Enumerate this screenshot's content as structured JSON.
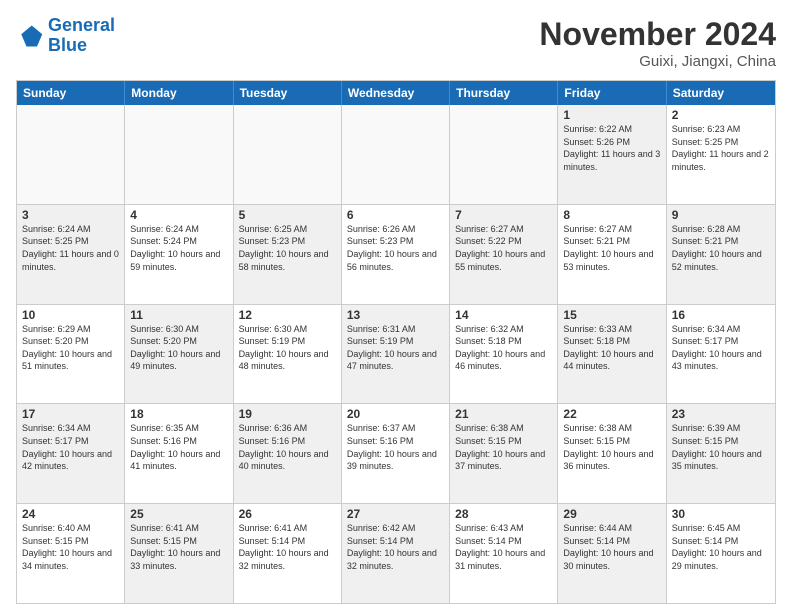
{
  "logo": {
    "line1": "General",
    "line2": "Blue"
  },
  "title": "November 2024",
  "subtitle": "Guixi, Jiangxi, China",
  "days_of_week": [
    "Sunday",
    "Monday",
    "Tuesday",
    "Wednesday",
    "Thursday",
    "Friday",
    "Saturday"
  ],
  "weeks": [
    [
      {
        "day": "",
        "info": "",
        "empty": true
      },
      {
        "day": "",
        "info": "",
        "empty": true
      },
      {
        "day": "",
        "info": "",
        "empty": true
      },
      {
        "day": "",
        "info": "",
        "empty": true
      },
      {
        "day": "",
        "info": "",
        "empty": true
      },
      {
        "day": "1",
        "info": "Sunrise: 6:22 AM\nSunset: 5:26 PM\nDaylight: 11 hours and 3 minutes.",
        "shaded": true
      },
      {
        "day": "2",
        "info": "Sunrise: 6:23 AM\nSunset: 5:25 PM\nDaylight: 11 hours and 2 minutes.",
        "shaded": false
      }
    ],
    [
      {
        "day": "3",
        "info": "Sunrise: 6:24 AM\nSunset: 5:25 PM\nDaylight: 11 hours and 0 minutes.",
        "shaded": true
      },
      {
        "day": "4",
        "info": "Sunrise: 6:24 AM\nSunset: 5:24 PM\nDaylight: 10 hours and 59 minutes.",
        "shaded": false
      },
      {
        "day": "5",
        "info": "Sunrise: 6:25 AM\nSunset: 5:23 PM\nDaylight: 10 hours and 58 minutes.",
        "shaded": true
      },
      {
        "day": "6",
        "info": "Sunrise: 6:26 AM\nSunset: 5:23 PM\nDaylight: 10 hours and 56 minutes.",
        "shaded": false
      },
      {
        "day": "7",
        "info": "Sunrise: 6:27 AM\nSunset: 5:22 PM\nDaylight: 10 hours and 55 minutes.",
        "shaded": true
      },
      {
        "day": "8",
        "info": "Sunrise: 6:27 AM\nSunset: 5:21 PM\nDaylight: 10 hours and 53 minutes.",
        "shaded": false
      },
      {
        "day": "9",
        "info": "Sunrise: 6:28 AM\nSunset: 5:21 PM\nDaylight: 10 hours and 52 minutes.",
        "shaded": true
      }
    ],
    [
      {
        "day": "10",
        "info": "Sunrise: 6:29 AM\nSunset: 5:20 PM\nDaylight: 10 hours and 51 minutes.",
        "shaded": false
      },
      {
        "day": "11",
        "info": "Sunrise: 6:30 AM\nSunset: 5:20 PM\nDaylight: 10 hours and 49 minutes.",
        "shaded": true
      },
      {
        "day": "12",
        "info": "Sunrise: 6:30 AM\nSunset: 5:19 PM\nDaylight: 10 hours and 48 minutes.",
        "shaded": false
      },
      {
        "day": "13",
        "info": "Sunrise: 6:31 AM\nSunset: 5:19 PM\nDaylight: 10 hours and 47 minutes.",
        "shaded": true
      },
      {
        "day": "14",
        "info": "Sunrise: 6:32 AM\nSunset: 5:18 PM\nDaylight: 10 hours and 46 minutes.",
        "shaded": false
      },
      {
        "day": "15",
        "info": "Sunrise: 6:33 AM\nSunset: 5:18 PM\nDaylight: 10 hours and 44 minutes.",
        "shaded": true
      },
      {
        "day": "16",
        "info": "Sunrise: 6:34 AM\nSunset: 5:17 PM\nDaylight: 10 hours and 43 minutes.",
        "shaded": false
      }
    ],
    [
      {
        "day": "17",
        "info": "Sunrise: 6:34 AM\nSunset: 5:17 PM\nDaylight: 10 hours and 42 minutes.",
        "shaded": true
      },
      {
        "day": "18",
        "info": "Sunrise: 6:35 AM\nSunset: 5:16 PM\nDaylight: 10 hours and 41 minutes.",
        "shaded": false
      },
      {
        "day": "19",
        "info": "Sunrise: 6:36 AM\nSunset: 5:16 PM\nDaylight: 10 hours and 40 minutes.",
        "shaded": true
      },
      {
        "day": "20",
        "info": "Sunrise: 6:37 AM\nSunset: 5:16 PM\nDaylight: 10 hours and 39 minutes.",
        "shaded": false
      },
      {
        "day": "21",
        "info": "Sunrise: 6:38 AM\nSunset: 5:15 PM\nDaylight: 10 hours and 37 minutes.",
        "shaded": true
      },
      {
        "day": "22",
        "info": "Sunrise: 6:38 AM\nSunset: 5:15 PM\nDaylight: 10 hours and 36 minutes.",
        "shaded": false
      },
      {
        "day": "23",
        "info": "Sunrise: 6:39 AM\nSunset: 5:15 PM\nDaylight: 10 hours and 35 minutes.",
        "shaded": true
      }
    ],
    [
      {
        "day": "24",
        "info": "Sunrise: 6:40 AM\nSunset: 5:15 PM\nDaylight: 10 hours and 34 minutes.",
        "shaded": false
      },
      {
        "day": "25",
        "info": "Sunrise: 6:41 AM\nSunset: 5:15 PM\nDaylight: 10 hours and 33 minutes.",
        "shaded": true
      },
      {
        "day": "26",
        "info": "Sunrise: 6:41 AM\nSunset: 5:14 PM\nDaylight: 10 hours and 32 minutes.",
        "shaded": false
      },
      {
        "day": "27",
        "info": "Sunrise: 6:42 AM\nSunset: 5:14 PM\nDaylight: 10 hours and 32 minutes.",
        "shaded": true
      },
      {
        "day": "28",
        "info": "Sunrise: 6:43 AM\nSunset: 5:14 PM\nDaylight: 10 hours and 31 minutes.",
        "shaded": false
      },
      {
        "day": "29",
        "info": "Sunrise: 6:44 AM\nSunset: 5:14 PM\nDaylight: 10 hours and 30 minutes.",
        "shaded": true
      },
      {
        "day": "30",
        "info": "Sunrise: 6:45 AM\nSunset: 5:14 PM\nDaylight: 10 hours and 29 minutes.",
        "shaded": false
      }
    ]
  ]
}
